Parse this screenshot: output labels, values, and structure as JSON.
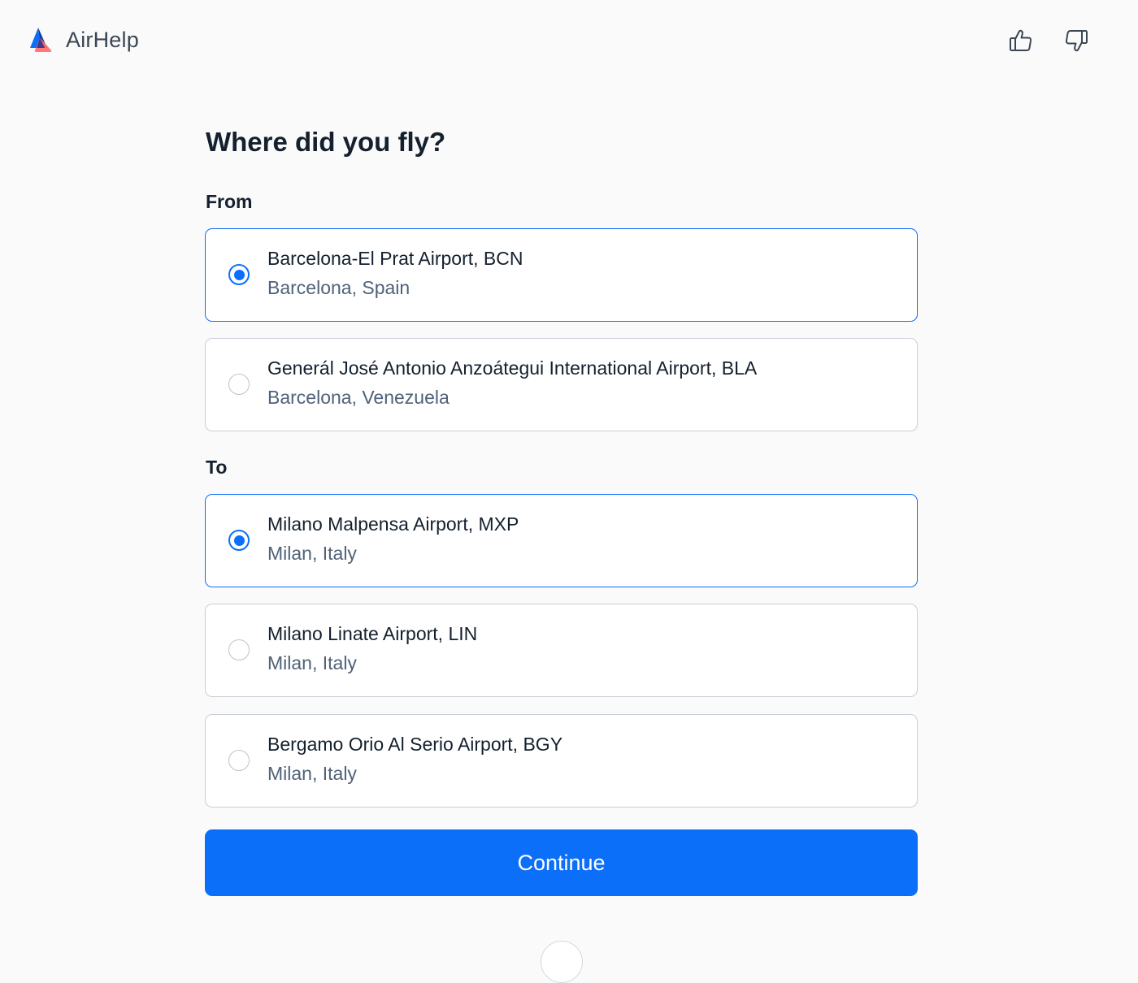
{
  "brand": {
    "name": "AirHelp",
    "logo_icon": "airhelp-logo-icon"
  },
  "header": {
    "feedback_icons": [
      "thumbs-up-icon",
      "thumbs-down-icon"
    ]
  },
  "page": {
    "title": "Where did you fly?"
  },
  "from": {
    "label": "From",
    "options": [
      {
        "title": "Barcelona-El Prat Airport, BCN",
        "subtitle": "Barcelona, Spain",
        "selected": true
      },
      {
        "title": "Generál José Antonio Anzoátegui International Airport, BLA",
        "subtitle": "Barcelona, Venezuela",
        "selected": false
      }
    ]
  },
  "to": {
    "label": "To",
    "options": [
      {
        "title": "Milano Malpensa Airport, MXP",
        "subtitle": "Milan, Italy",
        "selected": true
      },
      {
        "title": "Milano Linate Airport, LIN",
        "subtitle": "Milan, Italy",
        "selected": false
      },
      {
        "title": "Bergamo Orio Al Serio Airport, BGY",
        "subtitle": "Milan, Italy",
        "selected": false
      }
    ]
  },
  "actions": {
    "continue_label": "Continue"
  },
  "colors": {
    "accent": "#0c6ff9",
    "text_primary": "#14202e",
    "text_secondary": "#4f6278",
    "border": "#c9cfd8",
    "background": "#fafafa"
  }
}
